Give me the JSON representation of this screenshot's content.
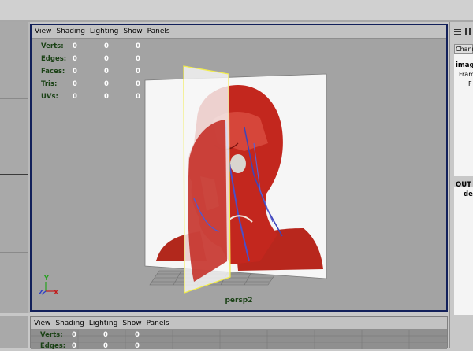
{
  "viewport_menu": [
    "View",
    "Shading",
    "Lighting",
    "Show",
    "Panels"
  ],
  "stats": [
    {
      "label": "Verts:",
      "values": [
        "0",
        "0",
        "0"
      ]
    },
    {
      "label": "Edges:",
      "values": [
        "0",
        "0",
        "0"
      ]
    },
    {
      "label": "Faces:",
      "values": [
        "0",
        "0",
        "0"
      ]
    },
    {
      "label": "Tris:",
      "values": [
        "0",
        "0",
        "0"
      ]
    },
    {
      "label": "UVs:",
      "values": [
        "0",
        "0",
        "0"
      ]
    }
  ],
  "camera_name": "persp2",
  "axis": {
    "y": "Y",
    "z": "Z",
    "x": "X"
  },
  "channel_box": {
    "tab": "Chann",
    "object": "imag",
    "frame": "Fram",
    "f": "F",
    "outliner": "OUT",
    "de": "de"
  },
  "bottom_menu": [
    "View",
    "Shading",
    "Lighting",
    "Show",
    "Panels"
  ],
  "bottom_stats": [
    {
      "label": "Verts:",
      "values": [
        "0",
        "0",
        "0"
      ]
    },
    {
      "label": "Edges:",
      "values": [
        "0",
        "0",
        "0"
      ]
    }
  ]
}
